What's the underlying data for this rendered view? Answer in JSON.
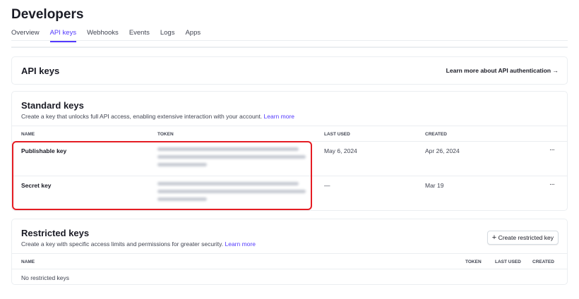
{
  "page": {
    "title": "Developers"
  },
  "tabs": [
    "Overview",
    "API keys",
    "Webhooks",
    "Events",
    "Logs",
    "Apps"
  ],
  "active_tab": "API keys",
  "api_card": {
    "title": "API keys",
    "link": "Learn more about API authentication →"
  },
  "standard": {
    "title": "Standard keys",
    "description": "Create a key that unlocks full API access, enabling extensive interaction with your account.",
    "learn_more": "Learn more",
    "columns": [
      "Name",
      "Token",
      "Last used",
      "Created"
    ],
    "rows": [
      {
        "name": "Publishable key",
        "last_used": "May 6, 2024",
        "created": "Apr 26, 2024"
      },
      {
        "name": "Secret key",
        "last_used": "—",
        "created": "Mar 19"
      }
    ],
    "more": "···"
  },
  "restricted": {
    "title": "Restricted keys",
    "description": "Create a key with specific access limits and permissions for greater security.",
    "learn_more": "Learn more",
    "button": "Create restricted key",
    "button_icon": "plus-icon",
    "columns": [
      "Name",
      "Token",
      "Last used",
      "Created"
    ],
    "empty": "No restricted keys"
  },
  "colors": {
    "accent": "#533afd",
    "highlight": "#e51c23"
  }
}
